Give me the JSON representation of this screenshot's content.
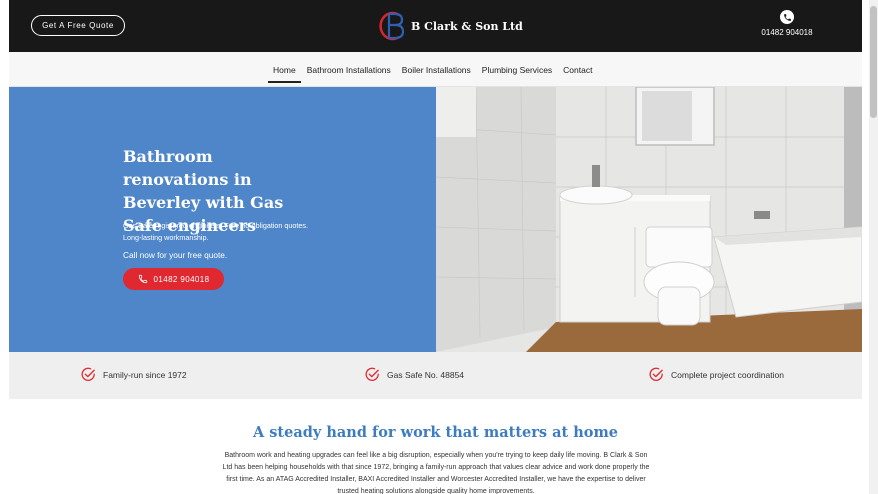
{
  "header": {
    "quote_button": "Get A Free Quote",
    "brand_name": "B Clark & Son Ltd",
    "phone": "01482 904018",
    "icons": {
      "phone": "phone-icon",
      "logo": "cb-monogram-logo"
    }
  },
  "nav": {
    "items": [
      "Home",
      "Bathroom Installations",
      "Boiler Installations",
      "Plumbing Services",
      "Contact"
    ],
    "active": "Home"
  },
  "hero": {
    "title": "Bathroom renovations in Beverley with Gas Safe engineers",
    "subtitle": "Gas Safe registered engineers. Free no-obligation quotes. Long-lasting workmanship.",
    "call_text": "Call now for your free quote.",
    "cta_phone": "01482 904018",
    "image": "bathroom-photo"
  },
  "features": [
    {
      "label": "Family-run since 1972",
      "icon": "check-circle-icon"
    },
    {
      "label": "Gas Safe No. 48854",
      "icon": "check-circle-icon"
    },
    {
      "label": "Complete project coordination",
      "icon": "check-circle-icon"
    }
  ],
  "about": {
    "title": "A steady hand for work that matters at home",
    "body": "Bathroom work and heating upgrades can feel like a big disruption, especially when you're trying to keep daily life moving. B Clark & Son Ltd has been helping households with that since 1972, bringing a family-run approach that values clear advice and work done properly the first time. As an ATAG Accredited Installer, BAXI Accredited Installer and Worcester Accredited Installer, we have the expertise to deliver trusted heating solutions alongside quality home improvements."
  },
  "colors": {
    "header_bg": "#181818",
    "hero_blue": "#4e86c9",
    "accent_red": "#e02830",
    "title_blue": "#3e7cc0"
  }
}
